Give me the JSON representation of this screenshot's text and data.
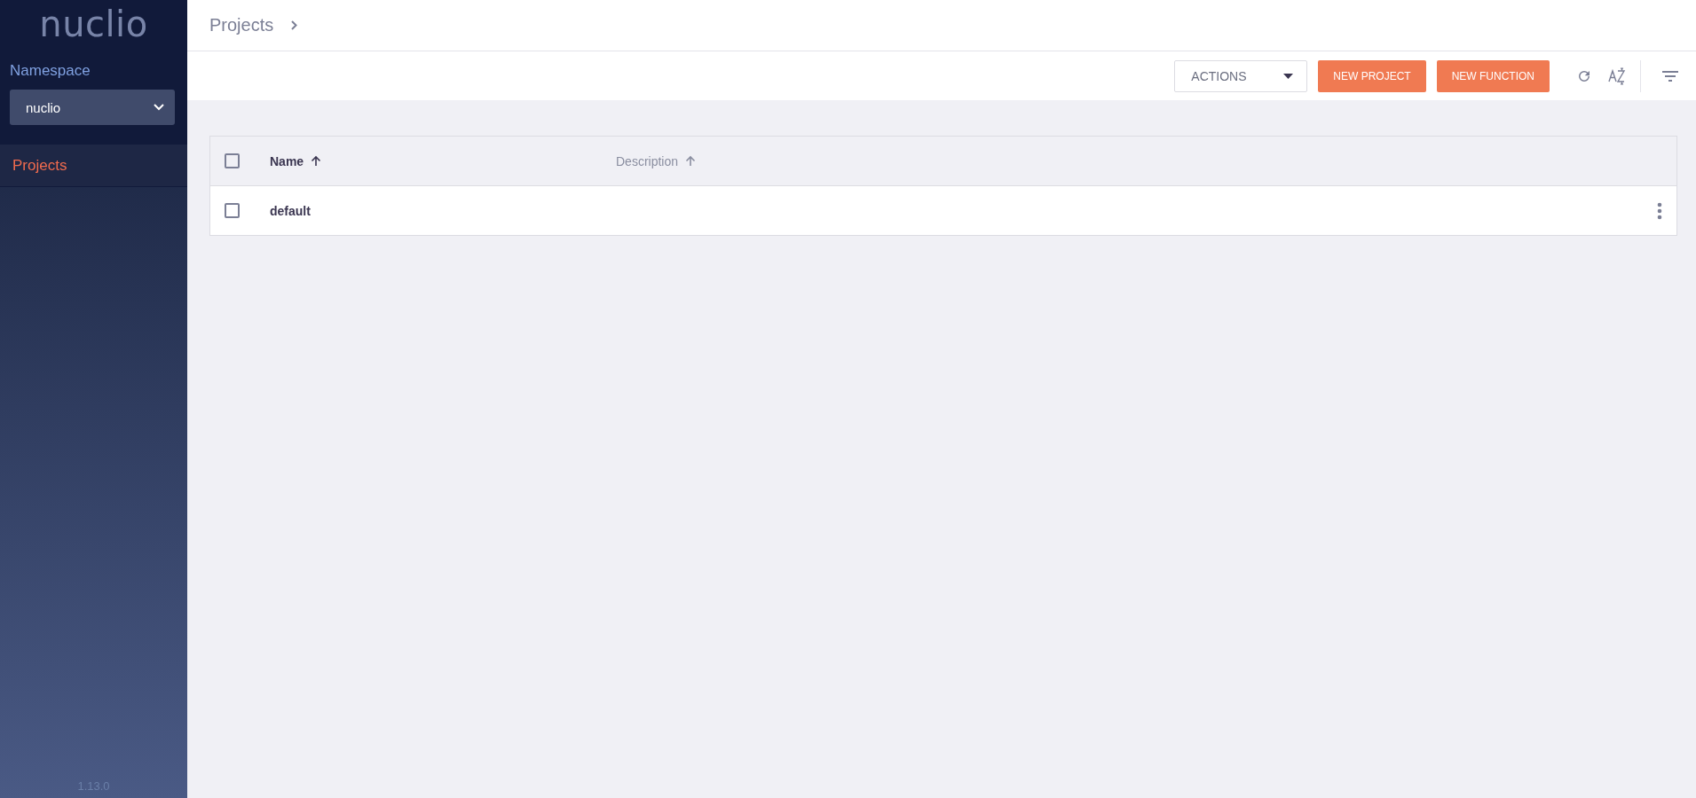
{
  "sidebar": {
    "logo": "nuclio",
    "namespace": {
      "label": "Namespace",
      "value": "nuclio"
    },
    "items": [
      {
        "label": "Projects",
        "selected": true
      }
    ],
    "version": "1.13.0"
  },
  "breadcrumbs": [
    "Projects"
  ],
  "toolbar": {
    "actions": "ACTIONS",
    "buttons": [
      "NEW PROJECT",
      "NEW FUNCTION"
    ]
  },
  "table": {
    "columns": [
      {
        "label": "Name",
        "sorted": true
      },
      {
        "label": "Description",
        "sorted": false
      }
    ],
    "all_checked": false,
    "rows": [
      {
        "name": "default",
        "checked": false
      }
    ]
  }
}
